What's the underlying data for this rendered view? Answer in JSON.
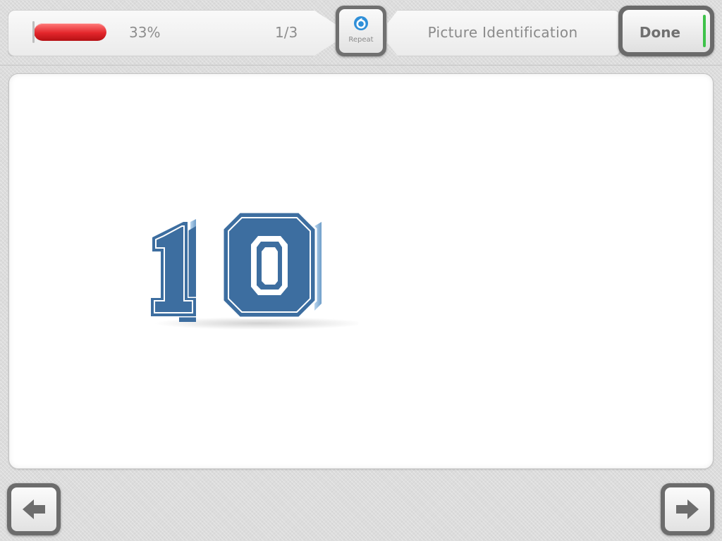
{
  "header": {
    "progress": {
      "percent_label": "33%",
      "fraction": 0.33,
      "fill_color": "#e3262b"
    },
    "question_count": "1/3",
    "activity_title": "Picture Identification",
    "repeat_button": {
      "label": "Repeat",
      "icon": "repeat-icon",
      "icon_color": "#2f8fd8"
    },
    "done_button": {
      "label": "Done",
      "indicator_color": "#3ec24a"
    }
  },
  "content": {
    "picture": {
      "number_shown": "10",
      "primary_color": "#3d6ea0",
      "outline_color": "#ffffff"
    }
  },
  "navigation": {
    "prev_icon": "arrow-left-icon",
    "next_icon": "arrow-right-icon",
    "arrow_color": "#6d6d6d"
  }
}
